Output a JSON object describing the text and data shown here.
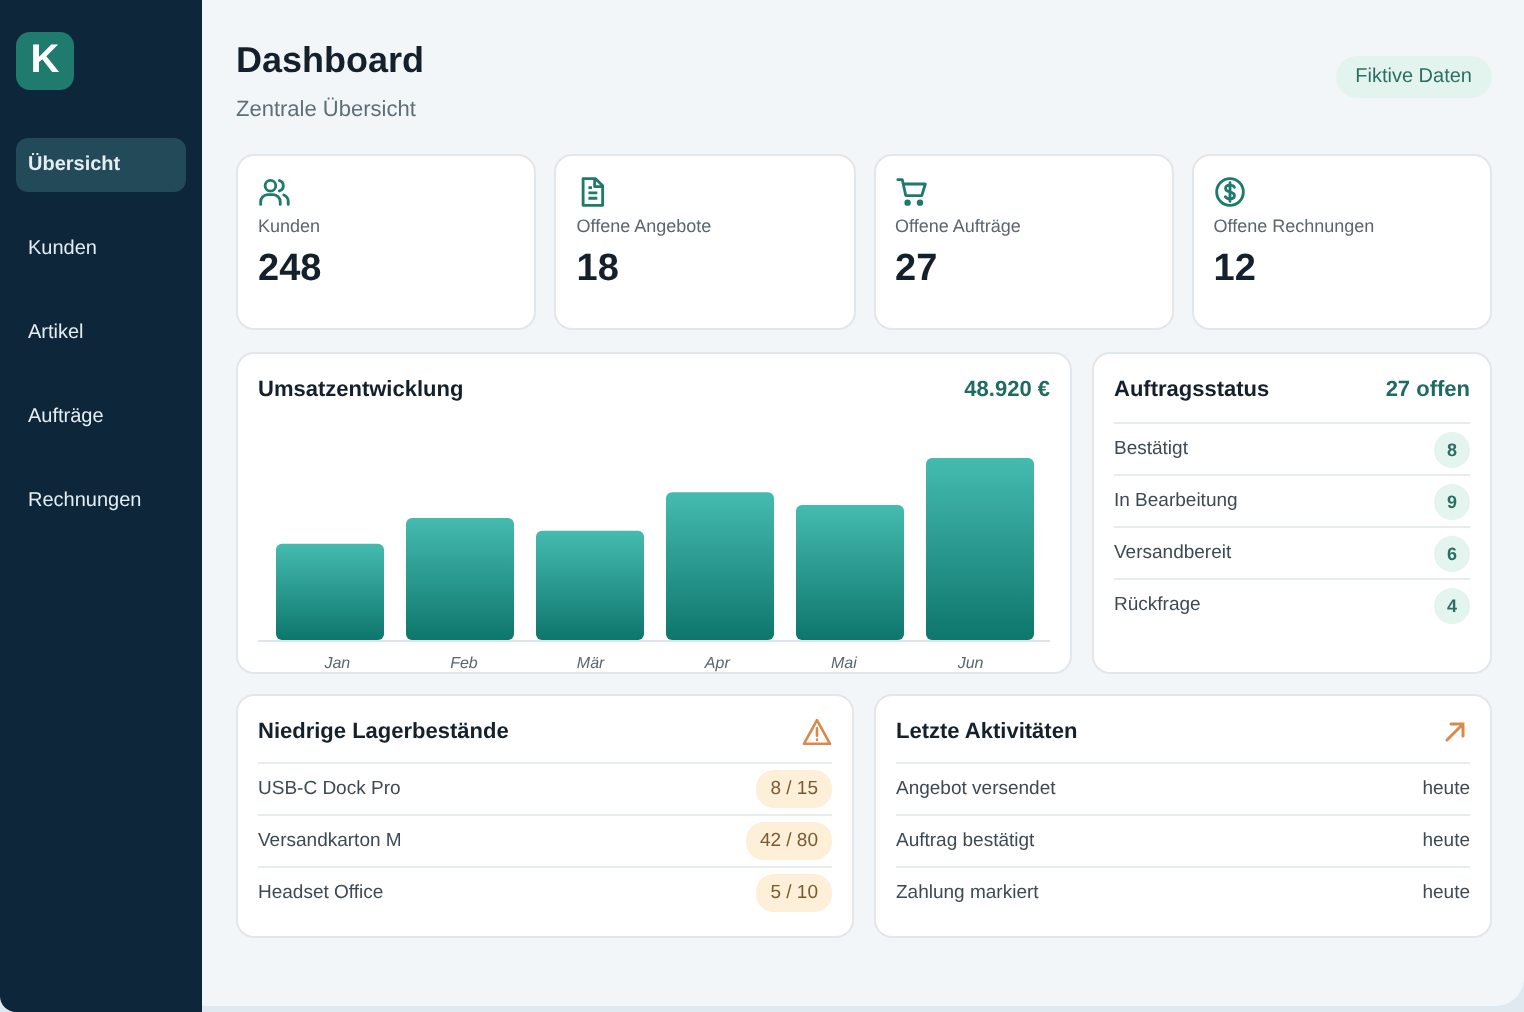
{
  "sidebar": {
    "logo": "K",
    "items": [
      {
        "label": "Übersicht",
        "selected": true
      },
      {
        "label": "Kunden",
        "selected": false
      },
      {
        "label": "Artikel",
        "selected": false
      },
      {
        "label": "Aufträge",
        "selected": false
      },
      {
        "label": "Rechnungen",
        "selected": false
      }
    ]
  },
  "header": {
    "title": "Dashboard",
    "subtitle": "Zentrale Übersicht",
    "badge": "Fiktive Daten"
  },
  "kpis": [
    {
      "kind": "users",
      "label": "Kunden",
      "value": "248"
    },
    {
      "kind": "document",
      "label": "Offene Angebote",
      "value": "18"
    },
    {
      "kind": "cart",
      "label": "Offene Aufträge",
      "value": "27"
    },
    {
      "kind": "money",
      "label": "Offene Rechnungen",
      "value": "12"
    }
  ],
  "revenue": {
    "title": "Umsatzentwicklung",
    "total": "48.920 €",
    "months": [
      "Jan",
      "Feb",
      "Mär",
      "Apr",
      "Mai",
      "Jun"
    ]
  },
  "order_status": {
    "title": "Auftragsstatus",
    "summary": "27 offen",
    "rows": [
      {
        "label": "Bestätigt",
        "count": "8"
      },
      {
        "label": "In Bearbeitung",
        "count": "9"
      },
      {
        "label": "Versandbereit",
        "count": "6"
      },
      {
        "label": "Rückfrage",
        "count": "4"
      }
    ]
  },
  "low_stock": {
    "title": "Niedrige Lagerbestände",
    "rows": [
      {
        "item": "USB-C Dock Pro",
        "stock": "8 / 15"
      },
      {
        "item": "Versandkarton M",
        "stock": "42 / 80"
      },
      {
        "item": "Headset Office",
        "stock": "5 / 10"
      }
    ]
  },
  "activities": {
    "title": "Letzte Aktivitäten",
    "rows": [
      {
        "text": "Angebot versendet",
        "time": "heute"
      },
      {
        "text": "Auftrag bestätigt",
        "time": "heute"
      },
      {
        "text": "Zahlung markiert",
        "time": "heute"
      }
    ]
  }
}
